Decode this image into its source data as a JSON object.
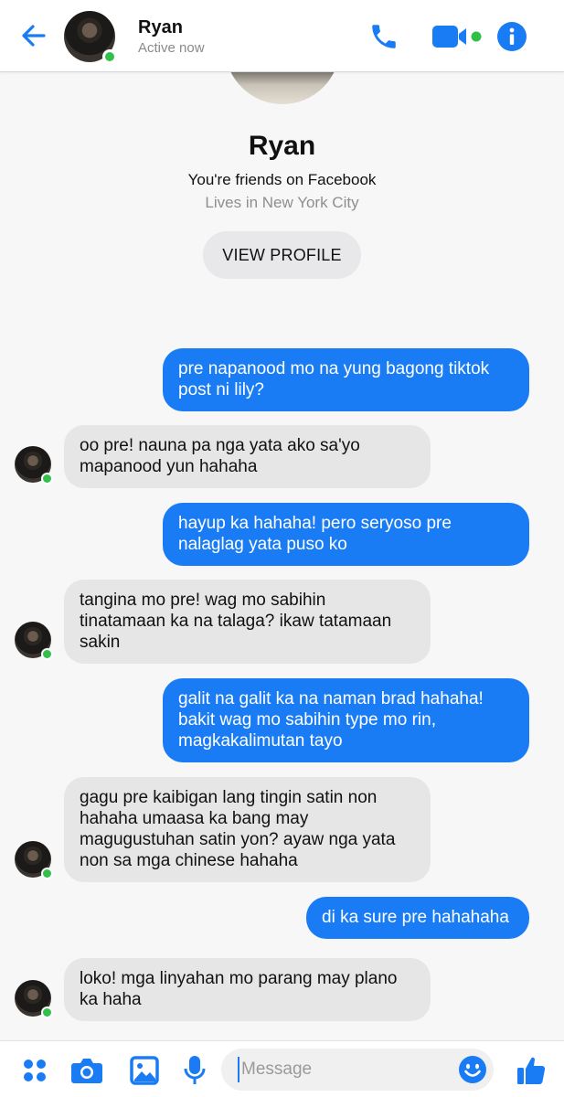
{
  "header": {
    "contact_name": "Ryan",
    "status": "Active now",
    "icons": [
      "back-arrow-icon",
      "phone-icon",
      "video-camera-icon",
      "info-icon"
    ]
  },
  "profile": {
    "name": "Ryan",
    "friends_text": "You're friends on Facebook",
    "location_text": "Lives in New York City",
    "view_profile_label": "VIEW PROFILE"
  },
  "messages": [
    {
      "from": "me",
      "text": "pre napanood mo na yung bagong tiktok post ni lily?"
    },
    {
      "from": "ryan",
      "text": "oo pre! nauna pa nga yata ako sa'yo mapanood yun hahaha"
    },
    {
      "from": "me",
      "text": "hayup ka hahaha! pero seryoso pre nalaglag yata puso ko"
    },
    {
      "from": "ryan",
      "text": "tangina mo pre! wag mo sabihin tinatamaan ka na talaga? ikaw tatamaan sakin"
    },
    {
      "from": "me",
      "text": "galit na galit ka na naman brad hahaha! bakit wag mo sabihin type mo rin, magkakalimutan tayo"
    },
    {
      "from": "ryan",
      "text": "gagu pre kaibigan lang tingin satin non hahaha umaasa ka bang may magugustuhan satin yon? ayaw nga yata non sa mga chinese hahaha"
    },
    {
      "from": "me",
      "text": "di ka sure pre hahahaha"
    },
    {
      "from": "ryan",
      "text": "loko! mga linyahan mo parang may plano ka haha"
    }
  ],
  "composer": {
    "placeholder": "Message",
    "icons": [
      "apps-grid-icon",
      "camera-icon",
      "image-icon",
      "microphone-icon",
      "emoji-icon",
      "thumbs-up-icon"
    ]
  },
  "colors": {
    "accent": "#1a7cf5",
    "outgoing_bubble": "#1a7cf5",
    "incoming_bubble": "#e6e6e7",
    "online": "#31c048"
  }
}
